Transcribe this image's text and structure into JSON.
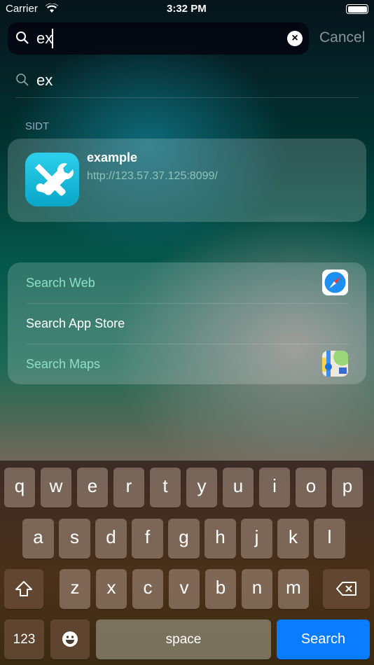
{
  "status_bar": {
    "carrier": "Carrier",
    "time": "3:32 PM",
    "wifi_icon": "wifi-icon",
    "battery_icon": "battery-icon"
  },
  "search": {
    "value": "ex",
    "cancel_label": "Cancel",
    "clear_icon": "clear-icon"
  },
  "suggestion": {
    "text": "ex"
  },
  "section": {
    "title": "SIDT"
  },
  "result": {
    "title": "example",
    "url": "http://123.57.37.125:8099/",
    "icon": "tools-icon",
    "icon_color": "#18b8dc"
  },
  "actions": [
    {
      "label": "Search Web",
      "icon": "safari-icon"
    },
    {
      "label": "Search App Store"
    },
    {
      "label": "Search Maps",
      "icon": "maps-icon"
    }
  ],
  "keyboard": {
    "row1": [
      "q",
      "w",
      "e",
      "r",
      "t",
      "y",
      "u",
      "i",
      "o",
      "p"
    ],
    "row2": [
      "a",
      "s",
      "d",
      "f",
      "g",
      "h",
      "j",
      "k",
      "l"
    ],
    "row3": [
      "z",
      "x",
      "c",
      "v",
      "b",
      "n",
      "m"
    ],
    "numbers_label": "123",
    "space_label": "space",
    "search_label": "Search",
    "accent": "#0a7cff"
  }
}
